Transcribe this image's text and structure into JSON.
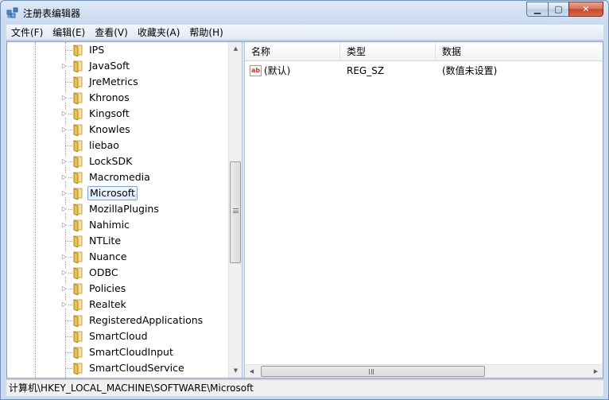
{
  "window": {
    "title": "注册表编辑器",
    "close_symbol": "✕",
    "minimize_symbol": "▁",
    "maximize_symbol": "▢"
  },
  "menu": [
    "文件(F)",
    "编辑(E)",
    "查看(V)",
    "收藏夹(A)",
    "帮助(H)"
  ],
  "tree": {
    "items": [
      {
        "label": "IPS",
        "expandable": false
      },
      {
        "label": "JavaSoft",
        "expandable": true
      },
      {
        "label": "JreMetrics",
        "expandable": false
      },
      {
        "label": "Khronos",
        "expandable": true
      },
      {
        "label": "Kingsoft",
        "expandable": true
      },
      {
        "label": "Knowles",
        "expandable": true
      },
      {
        "label": "liebao",
        "expandable": false
      },
      {
        "label": "LockSDK",
        "expandable": true
      },
      {
        "label": "Macromedia",
        "expandable": true
      },
      {
        "label": "Microsoft",
        "expandable": true,
        "selected": true
      },
      {
        "label": "MozillaPlugins",
        "expandable": true
      },
      {
        "label": "Nahimic",
        "expandable": true
      },
      {
        "label": "NTLite",
        "expandable": false
      },
      {
        "label": "Nuance",
        "expandable": true
      },
      {
        "label": "ODBC",
        "expandable": true
      },
      {
        "label": "Policies",
        "expandable": true
      },
      {
        "label": "Realtek",
        "expandable": true
      },
      {
        "label": "RegisteredApplications",
        "expandable": false
      },
      {
        "label": "SmartCloud",
        "expandable": false
      },
      {
        "label": "SmartCloudInput",
        "expandable": false
      },
      {
        "label": "SmartCloudService",
        "expandable": false
      }
    ],
    "expander_symbol": "▷"
  },
  "list": {
    "columns": [
      "名称",
      "类型",
      "数据"
    ],
    "rows": [
      {
        "icon": "ab",
        "name": "(默认)",
        "type": "REG_SZ",
        "data": "(数值未设置)"
      }
    ]
  },
  "scroll": {
    "up": "▲",
    "down": "▼",
    "left": "◀",
    "right": "▶"
  },
  "status": "计算机\\HKEY_LOCAL_MACHINE\\SOFTWARE\\Microsoft",
  "colors": {
    "folder": "#e8c24a",
    "selection_border": "#7da2ce",
    "title_bar": "#c9d9ee"
  }
}
